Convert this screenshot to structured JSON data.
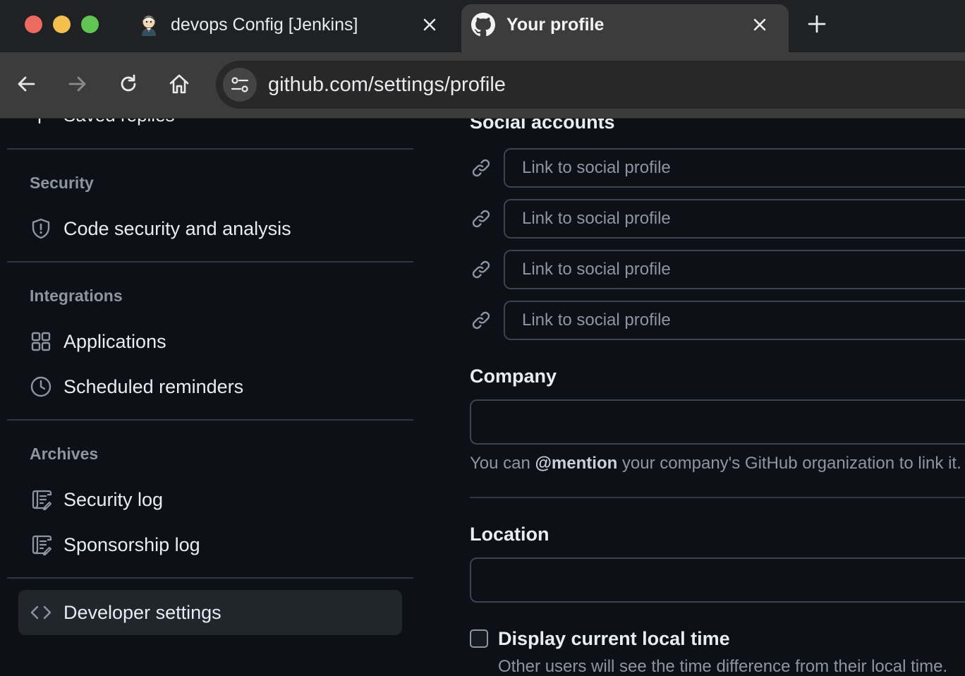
{
  "browser": {
    "tabs": [
      {
        "title": "devops Config [Jenkins]",
        "icon": "jenkins-icon",
        "active": false
      },
      {
        "title": "Your profile",
        "icon": "github-icon",
        "active": true
      }
    ],
    "url": "github.com/settings/profile"
  },
  "sidebar": {
    "cut_item": "Saved replies",
    "sections": [
      {
        "heading": "Security",
        "items": [
          {
            "label": "Code security and analysis",
            "icon": "shield-icon"
          }
        ]
      },
      {
        "heading": "Integrations",
        "items": [
          {
            "label": "Applications",
            "icon": "apps-grid-icon"
          },
          {
            "label": "Scheduled reminders",
            "icon": "clock-icon"
          }
        ]
      },
      {
        "heading": "Archives",
        "items": [
          {
            "label": "Security log",
            "icon": "log-icon"
          },
          {
            "label": "Sponsorship log",
            "icon": "log-icon"
          }
        ]
      }
    ],
    "developer_settings": {
      "label": "Developer settings",
      "icon": "code-icon"
    }
  },
  "main": {
    "social_accounts": {
      "heading": "Social accounts",
      "links": [
        {
          "value": "",
          "placeholder": "Link to social profile"
        },
        {
          "value": "",
          "placeholder": "Link to social profile"
        },
        {
          "value": "",
          "placeholder": "Link to social profile"
        },
        {
          "value": "",
          "placeholder": "Link to social profile"
        }
      ]
    },
    "company": {
      "heading": "Company",
      "value": "",
      "hint_prefix": "You can ",
      "hint_mention": "@mention",
      "hint_suffix": " your company's GitHub organization to link it."
    },
    "location": {
      "heading": "Location",
      "value": ""
    },
    "local_time": {
      "label": "Display current local time",
      "checked": false,
      "hint": "Other users will see the time difference from their local time."
    }
  },
  "colors": {
    "background": "#0d1117",
    "border": "#30363d",
    "muted_text": "#8d96a0",
    "text": "#e6edf3",
    "active_item": "#21262d"
  }
}
